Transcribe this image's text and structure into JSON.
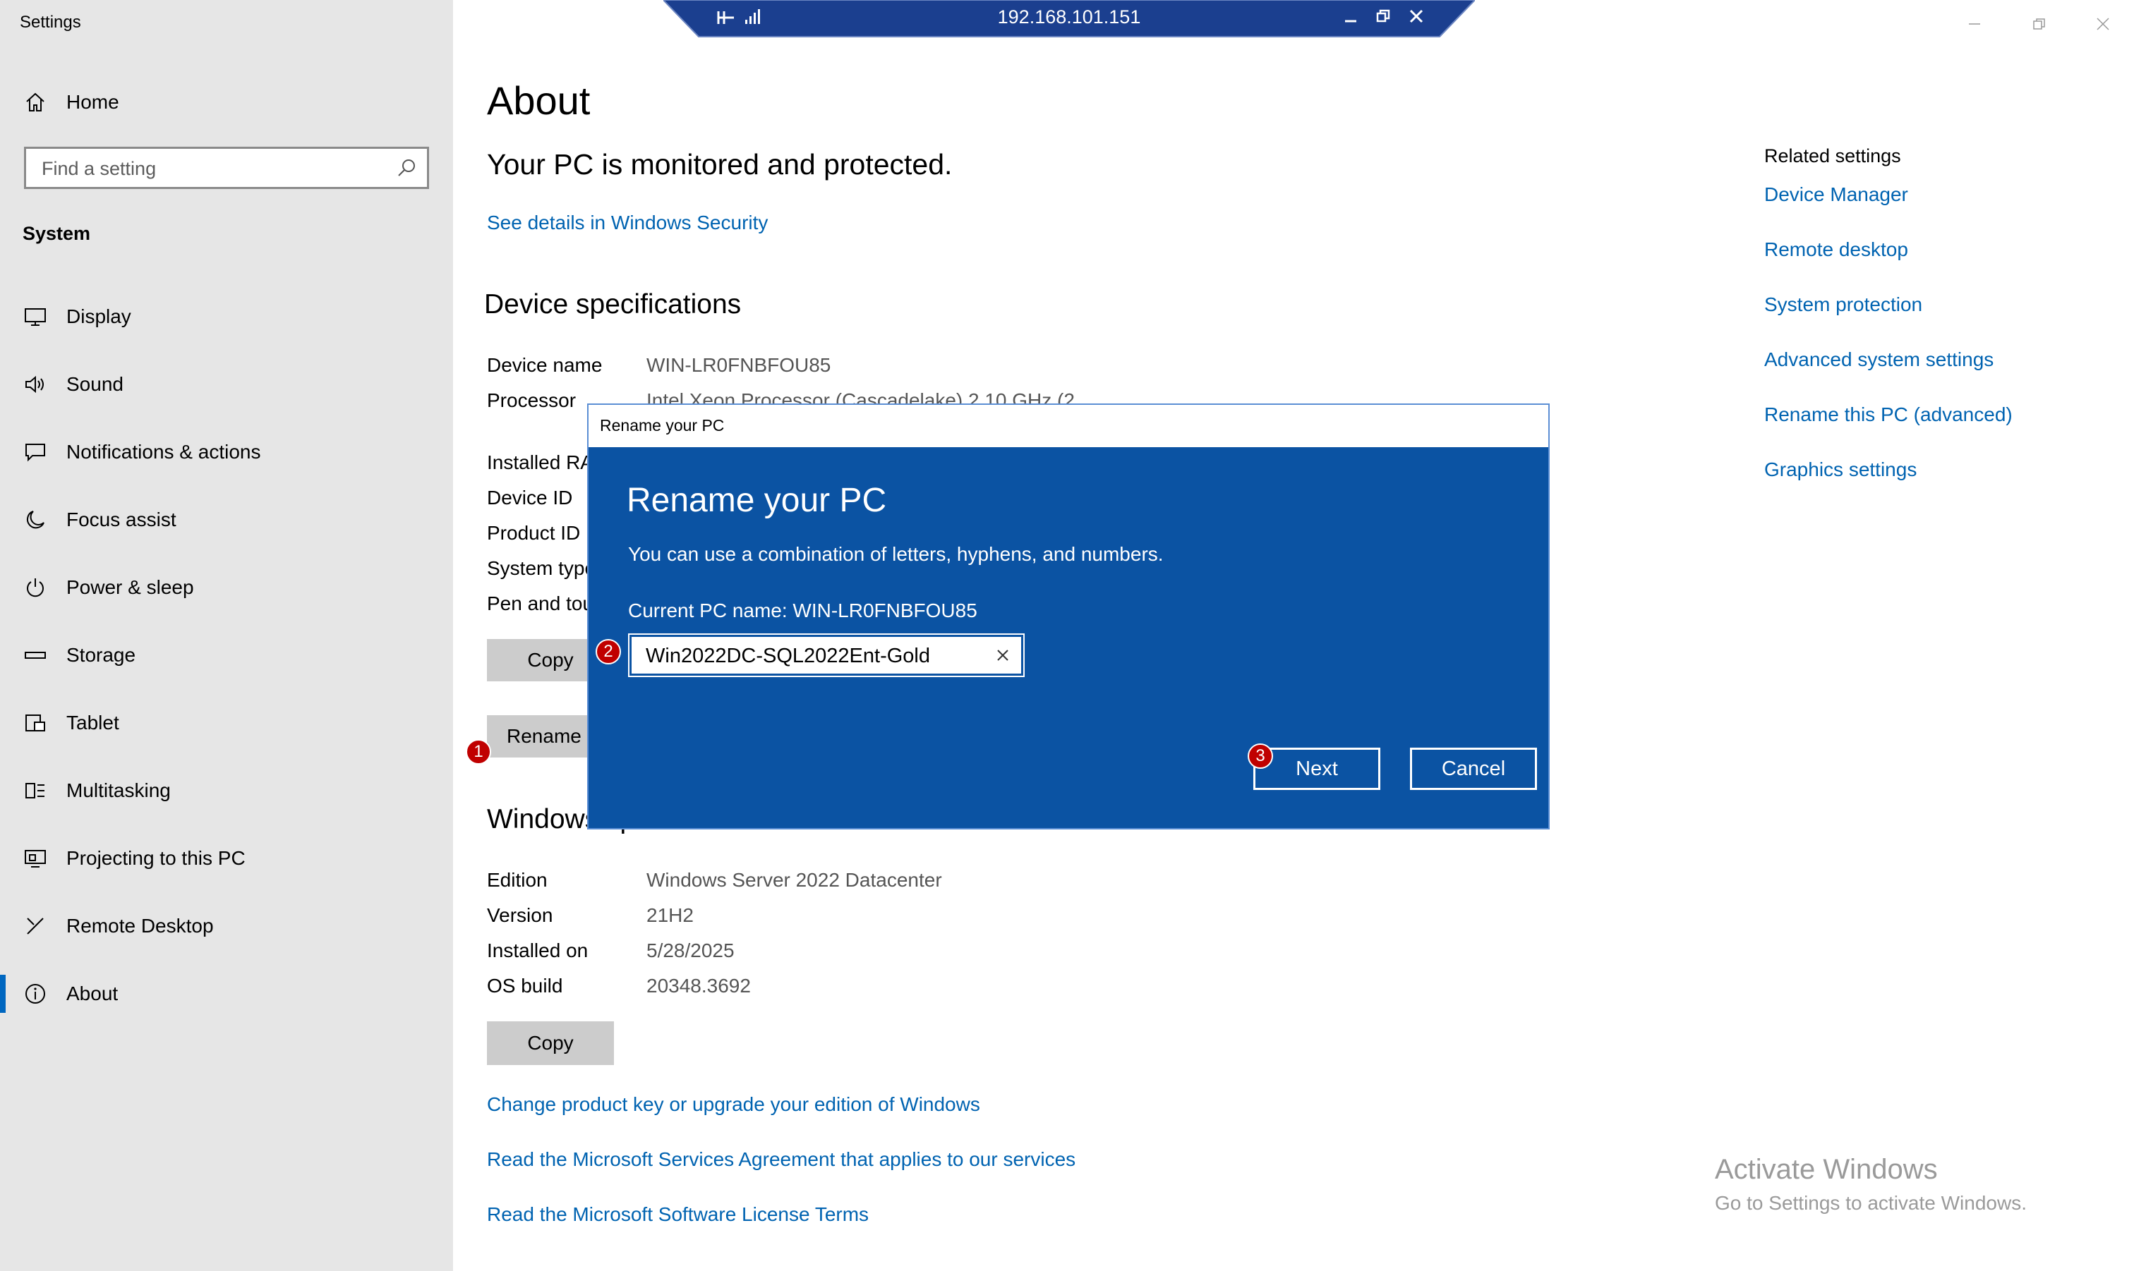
{
  "window": {
    "title": "Settings"
  },
  "rdp_bar": {
    "host": "192.168.101.151"
  },
  "sidebar": {
    "home_label": "Home",
    "search_placeholder": "Find a setting",
    "section_title": "System",
    "items": [
      {
        "label": "Display",
        "icon": "display-icon"
      },
      {
        "label": "Sound",
        "icon": "sound-icon"
      },
      {
        "label": "Notifications & actions",
        "icon": "notifications-icon"
      },
      {
        "label": "Focus assist",
        "icon": "moon-icon"
      },
      {
        "label": "Power & sleep",
        "icon": "power-icon"
      },
      {
        "label": "Storage",
        "icon": "storage-icon"
      },
      {
        "label": "Tablet",
        "icon": "tablet-icon"
      },
      {
        "label": "Multitasking",
        "icon": "multitasking-icon"
      },
      {
        "label": "Projecting to this PC",
        "icon": "projecting-icon"
      },
      {
        "label": "Remote Desktop",
        "icon": "remote-desktop-icon"
      },
      {
        "label": "About",
        "icon": "info-icon",
        "selected": true
      }
    ]
  },
  "main": {
    "title": "About",
    "protected_text": "Your PC is monitored and protected.",
    "security_link": "See details in Windows Security",
    "device_specs_title": "Device specifications",
    "device_specs": [
      {
        "label": "Device name",
        "value": "WIN-LR0FNBFOU85"
      },
      {
        "label": "Processor",
        "value": "Intel Xeon Processor (Cascadelake)   2.10 GHz  (2"
      },
      {
        "label": "Installed RA",
        "value": ""
      },
      {
        "label": "Device ID",
        "value": ""
      },
      {
        "label": "Product ID",
        "value": ""
      },
      {
        "label": "System type",
        "value": ""
      },
      {
        "label": "Pen and tou",
        "value": ""
      }
    ],
    "copy_label": "Copy",
    "rename_label": "Rename t",
    "windows_specs_title": "Windows specifications",
    "windows_specs": [
      {
        "label": "Edition",
        "value": "Windows Server 2022 Datacenter"
      },
      {
        "label": "Version",
        "value": "21H2"
      },
      {
        "label": "Installed on",
        "value": "5/28/2025"
      },
      {
        "label": "OS build",
        "value": "20348.3692"
      }
    ],
    "copy2_label": "Copy",
    "links": [
      "Change product key or upgrade your edition of Windows",
      "Read the Microsoft Services Agreement that applies to our services",
      "Read the Microsoft Software License Terms"
    ]
  },
  "related": {
    "title": "Related settings",
    "links": [
      "Device Manager",
      "Remote desktop",
      "System protection",
      "Advanced system settings",
      "Rename this PC (advanced)",
      "Graphics settings"
    ]
  },
  "dialog": {
    "window_title": "Rename your PC",
    "heading": "Rename your PC",
    "description": "You can use a combination of letters, hyphens, and numbers.",
    "current_name": "Current PC name: WIN-LR0FNBFOU85",
    "input_value": "Win2022DC-SQL2022Ent-Gold",
    "next_label": "Next",
    "cancel_label": "Cancel"
  },
  "badges": {
    "one": "1",
    "two": "2",
    "three": "3"
  },
  "watermark": {
    "title": "Activate Windows",
    "subtitle": "Go to Settings to activate Windows."
  },
  "colors": {
    "accent": "#0063b1",
    "dialog_bg": "#0b53a3",
    "sidebar_bg": "#e6e6e6",
    "badge": "#c00000"
  }
}
